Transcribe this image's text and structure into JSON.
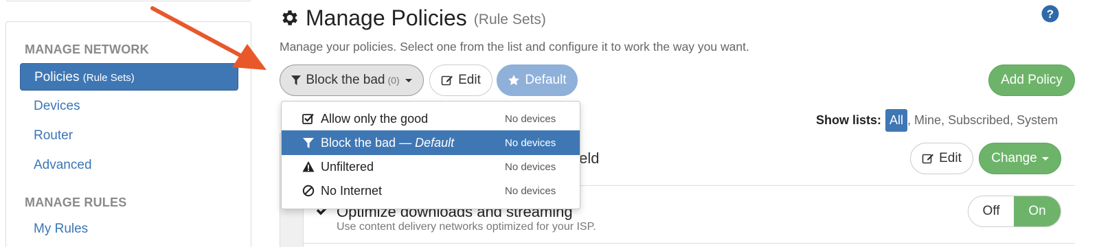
{
  "sidebar": {
    "sections": [
      {
        "heading": "MANAGE NETWORK",
        "items": [
          {
            "label": "Policies",
            "sub": "(Rule Sets)",
            "active": true
          },
          {
            "label": "Devices"
          },
          {
            "label": "Router"
          },
          {
            "label": "Advanced"
          }
        ]
      },
      {
        "heading": "MANAGE RULES",
        "items": [
          {
            "label": "My Rules"
          }
        ]
      }
    ]
  },
  "header": {
    "icon": "gear-icon",
    "title": "Manage Policies",
    "subtitle": "(Rule Sets)",
    "help_icon": "question-circle-icon",
    "description": "Manage your policies. Select one from the list and configure it to work the way you want."
  },
  "toolbar": {
    "policy_select": {
      "label": "Block the bad",
      "count": "(0)",
      "icon": "filter-icon"
    },
    "edit_label": "Edit",
    "default_label": "Default",
    "add_policy_label": "Add Policy"
  },
  "policy_dropdown": {
    "items": [
      {
        "label": "Allow only the good",
        "suffix": "",
        "meta": "No devices",
        "icon": "checkbox-icon",
        "active": false
      },
      {
        "label": "Block the bad — ",
        "suffix": "Default",
        "meta": "No devices",
        "icon": "filter-icon",
        "active": true
      },
      {
        "label": "Unfiltered",
        "suffix": "",
        "meta": "No devices",
        "icon": "warning-icon",
        "active": false
      },
      {
        "label": "No Internet",
        "suffix": "",
        "meta": "No devices",
        "icon": "ban-icon",
        "active": false
      }
    ]
  },
  "show_lists": {
    "label": "Show lists:",
    "options": [
      "All",
      ", Mine",
      ", Subscribed",
      ", System"
    ],
    "selected": "All"
  },
  "panel": {
    "header_text_partial": "hield",
    "edit_label": "Edit",
    "change_label": "Change",
    "option": {
      "title": "Optimize downloads and streaming",
      "description": "Use content delivery networks optimized for your ISP.",
      "toggle_off": "Off",
      "toggle_on": "On",
      "state": "On"
    }
  },
  "colors": {
    "primary": "#3f77b4",
    "success": "#6db46a",
    "default_button": "#8fb0d9",
    "arrow": "#e8582a"
  }
}
